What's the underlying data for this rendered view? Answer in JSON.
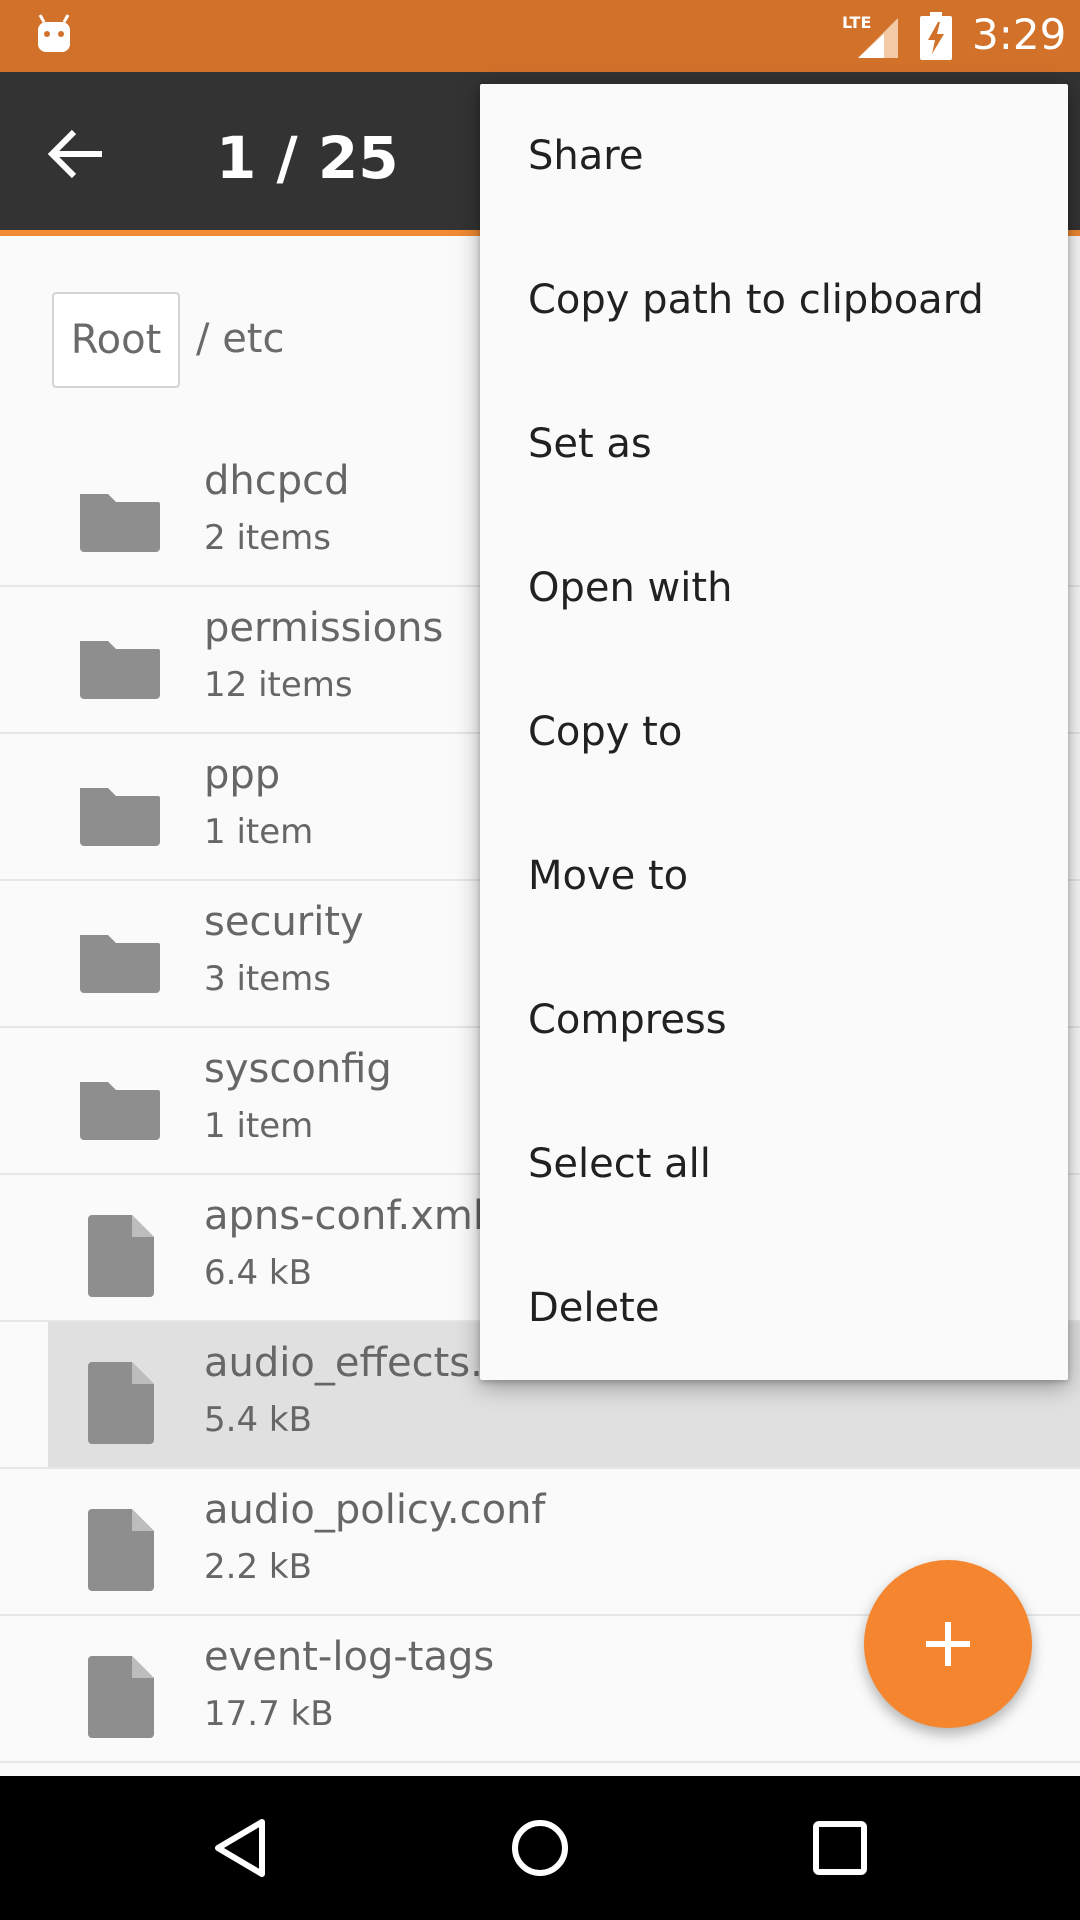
{
  "status_bar": {
    "time": "3:29",
    "network": "LTE",
    "bg_color": "#d2722a"
  },
  "app_bar": {
    "title": "1 / 25",
    "back_icon": "arrow-back-icon"
  },
  "breadcrumb": {
    "root_label": "Root",
    "path": "/ etc"
  },
  "files": [
    {
      "name": "dhcpcd",
      "size": "2 items",
      "type": "folder"
    },
    {
      "name": "permissions",
      "size": "12 items",
      "type": "folder"
    },
    {
      "name": "ppp",
      "size": "1 item",
      "type": "folder"
    },
    {
      "name": "security",
      "size": "3 items",
      "type": "folder"
    },
    {
      "name": "sysconfig",
      "size": "1 item",
      "type": "folder"
    },
    {
      "name": "apns-conf.xml",
      "size": "6.4 kB",
      "type": "file"
    },
    {
      "name": "audio_effects.c",
      "size": "5.4 kB",
      "type": "file",
      "selected": true
    },
    {
      "name": "audio_policy.conf",
      "size": "2.2 kB",
      "type": "file"
    },
    {
      "name": "event-log-tags",
      "size": "17.7 kB",
      "type": "file"
    }
  ],
  "menu": {
    "items": [
      "Share",
      "Copy path to clipboard",
      "Set as",
      "Open with",
      "Copy to",
      "Move to",
      "Compress",
      "Select all",
      "Delete"
    ]
  },
  "fab": {
    "icon": "plus-icon",
    "color": "#f5862f"
  },
  "nav_bar": {
    "icons": [
      "back-triangle-icon",
      "home-circle-icon",
      "recents-square-icon"
    ]
  }
}
